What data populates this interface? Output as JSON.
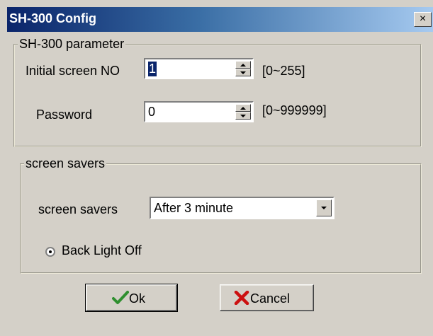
{
  "window": {
    "title": "SH-300 Config",
    "close_glyph": "×"
  },
  "parameter_group": {
    "legend": "SH-300 parameter",
    "initial_screen": {
      "label": "Initial screen NO",
      "value": "1",
      "range": "[0~255]"
    },
    "password": {
      "label": "Password",
      "value": "0",
      "range": "[0~999999]"
    }
  },
  "saver_group": {
    "legend": "screen savers",
    "saver": {
      "label": "screen savers",
      "selected": "After 3 minute"
    },
    "backlight": {
      "label": "Back Light Off",
      "checked": true
    }
  },
  "buttons": {
    "ok": "Ok",
    "cancel": "Cancel"
  },
  "colors": {
    "title_start": "#0a246a",
    "title_end": "#a6caf0",
    "face": "#d4d0c8",
    "ok_check": "#2f8f2f",
    "cancel_x": "#cc1010"
  }
}
